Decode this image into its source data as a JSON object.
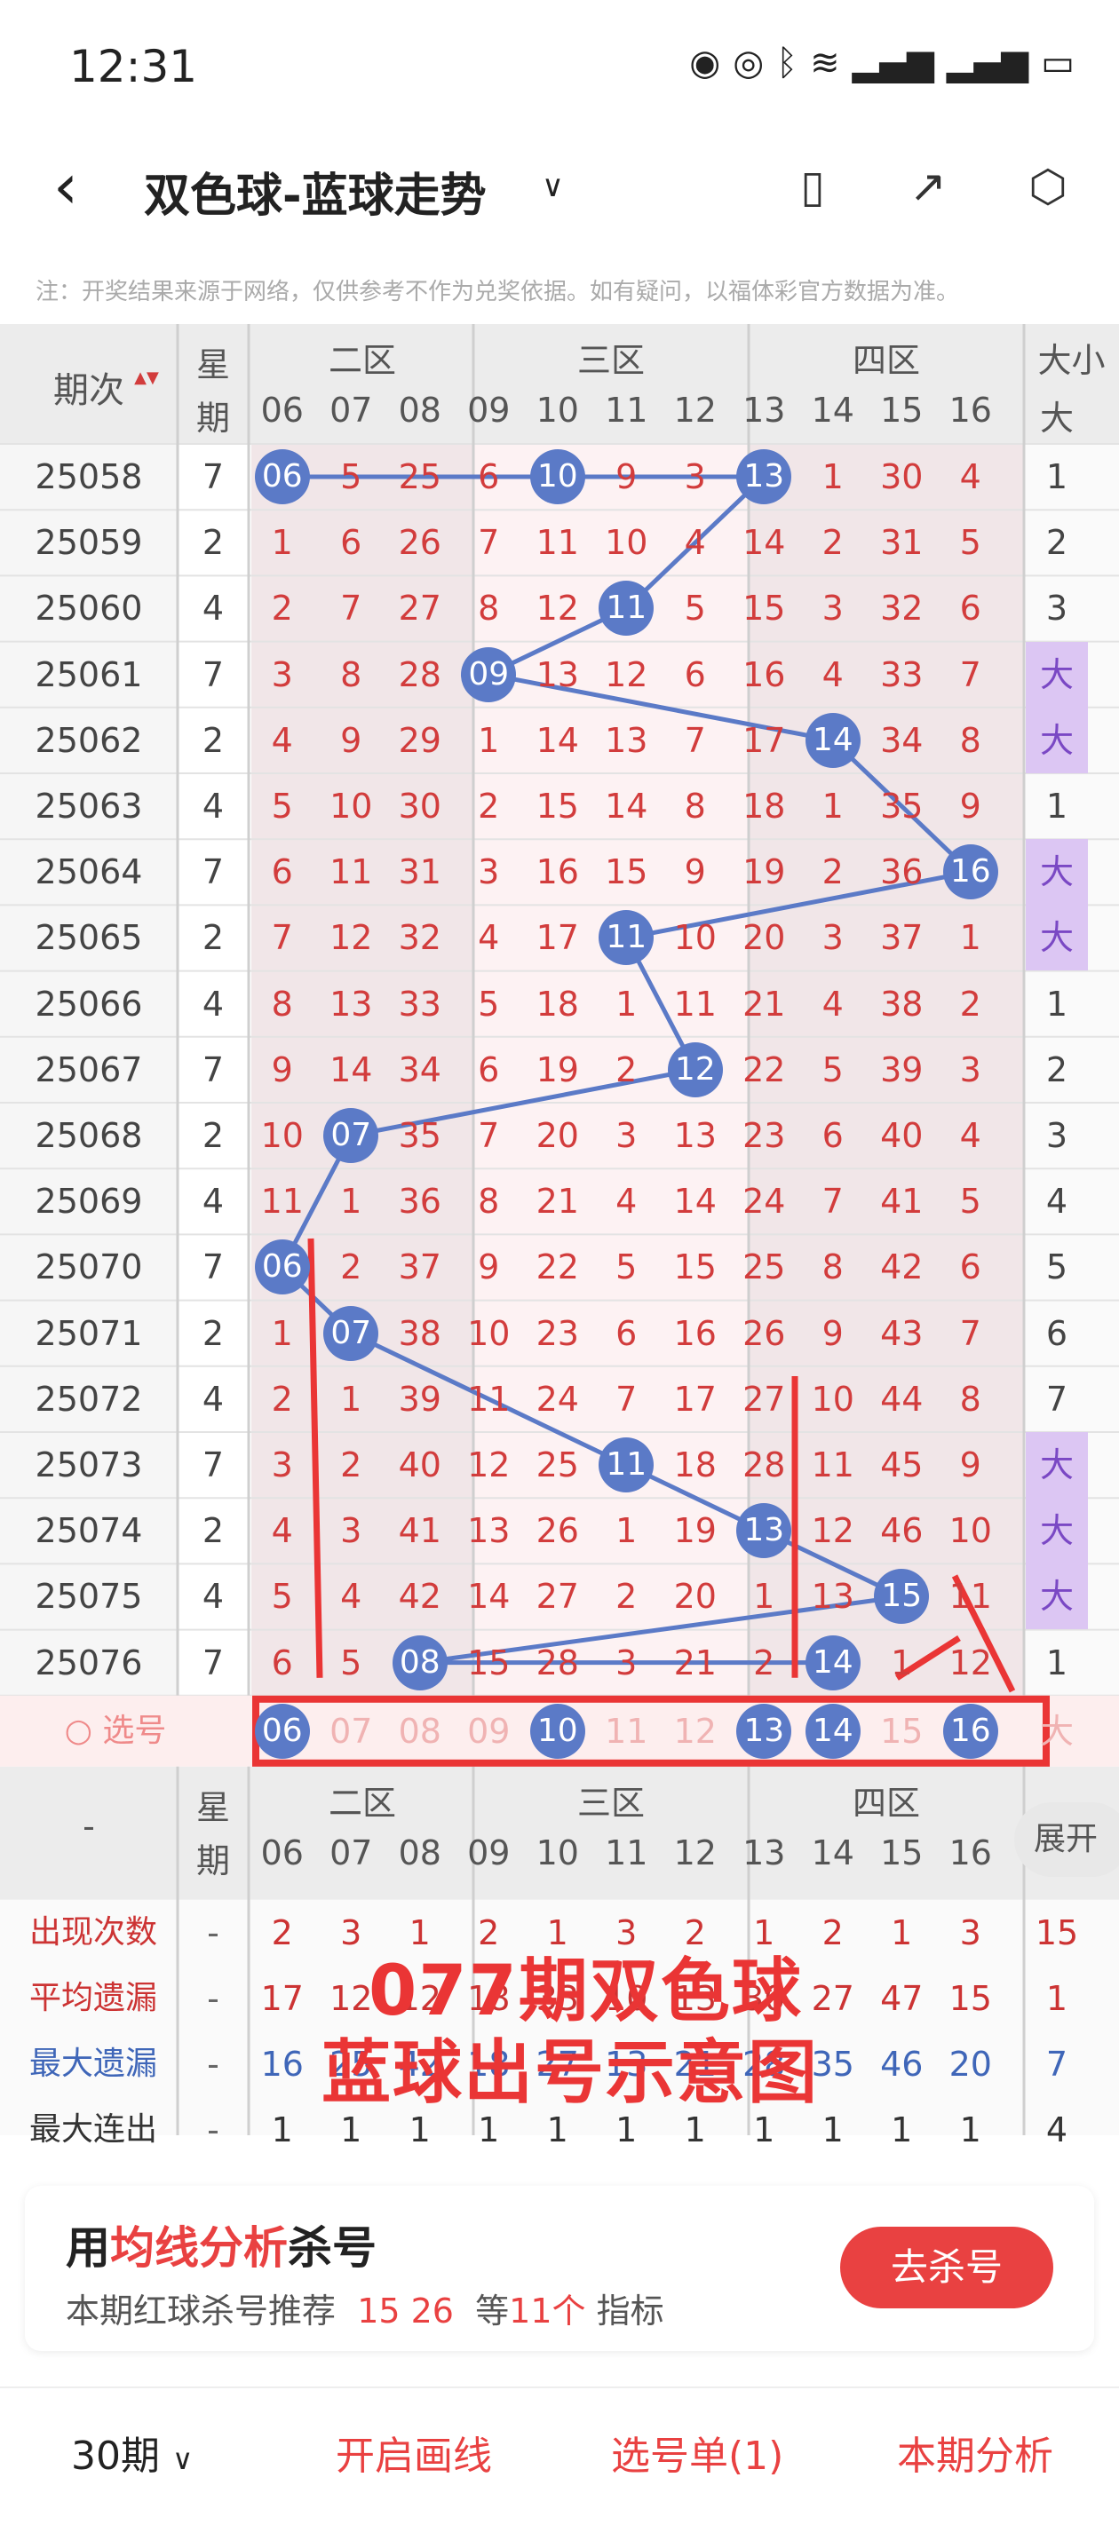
{
  "status": {
    "time": "12:31"
  },
  "header": {
    "title": "双色球-蓝球走势"
  },
  "note": "注：开奖结果来源于网络，仅供参考不作为兑奖依据。如有疑问，以福体彩官方数据为准。",
  "table": {
    "head_period": "期次",
    "head_week": "星期",
    "zones": [
      "二区",
      "三区",
      "四区",
      "大小"
    ],
    "numbers": [
      "06",
      "07",
      "08",
      "09",
      "10",
      "11",
      "12",
      "13",
      "14",
      "15",
      "16"
    ],
    "size_col_label": "大",
    "rows": [
      {
        "period": "25058",
        "week": "7",
        "vals": [
          "06",
          "5",
          "25",
          "6",
          "10",
          "9",
          "3",
          "13",
          "1",
          "30",
          "4"
        ],
        "size": "1"
      },
      {
        "period": "25059",
        "week": "2",
        "vals": [
          "1",
          "6",
          "26",
          "7",
          "11",
          "10",
          "4",
          "14",
          "2",
          "31",
          "5"
        ],
        "size": "2"
      },
      {
        "period": "25060",
        "week": "4",
        "vals": [
          "2",
          "7",
          "27",
          "8",
          "12",
          "11",
          "5",
          "15",
          "3",
          "32",
          "6"
        ],
        "size": "3"
      },
      {
        "period": "25061",
        "week": "7",
        "vals": [
          "3",
          "8",
          "28",
          "09",
          "13",
          "12",
          "6",
          "16",
          "4",
          "33",
          "7"
        ],
        "size": "大"
      },
      {
        "period": "25062",
        "week": "2",
        "vals": [
          "4",
          "9",
          "29",
          "1",
          "14",
          "13",
          "7",
          "17",
          "14",
          "34",
          "8"
        ],
        "size": "大"
      },
      {
        "period": "25063",
        "week": "4",
        "vals": [
          "5",
          "10",
          "30",
          "2",
          "15",
          "14",
          "8",
          "18",
          "1",
          "35",
          "9"
        ],
        "size": "1"
      },
      {
        "period": "25064",
        "week": "7",
        "vals": [
          "6",
          "11",
          "31",
          "3",
          "16",
          "15",
          "9",
          "19",
          "2",
          "36",
          "16"
        ],
        "size": "大"
      },
      {
        "period": "25065",
        "week": "2",
        "vals": [
          "7",
          "12",
          "32",
          "4",
          "17",
          "11",
          "10",
          "20",
          "3",
          "37",
          "1"
        ],
        "size": "大"
      },
      {
        "period": "25066",
        "week": "4",
        "vals": [
          "8",
          "13",
          "33",
          "5",
          "18",
          "1",
          "11",
          "21",
          "4",
          "38",
          "2"
        ],
        "size": "1"
      },
      {
        "period": "25067",
        "week": "7",
        "vals": [
          "9",
          "14",
          "34",
          "6",
          "19",
          "2",
          "12",
          "22",
          "5",
          "39",
          "3"
        ],
        "size": "2"
      },
      {
        "period": "25068",
        "week": "2",
        "vals": [
          "10",
          "07",
          "35",
          "7",
          "20",
          "3",
          "13",
          "23",
          "6",
          "40",
          "4"
        ],
        "size": "3"
      },
      {
        "period": "25069",
        "week": "4",
        "vals": [
          "11",
          "1",
          "36",
          "8",
          "21",
          "4",
          "14",
          "24",
          "7",
          "41",
          "5"
        ],
        "size": "4"
      },
      {
        "period": "25070",
        "week": "7",
        "vals": [
          "06",
          "2",
          "37",
          "9",
          "22",
          "5",
          "15",
          "25",
          "8",
          "42",
          "6"
        ],
        "size": "5"
      },
      {
        "period": "25071",
        "week": "2",
        "vals": [
          "1",
          "07",
          "38",
          "10",
          "23",
          "6",
          "16",
          "26",
          "9",
          "43",
          "7"
        ],
        "size": "6"
      },
      {
        "period": "25072",
        "week": "4",
        "vals": [
          "2",
          "1",
          "39",
          "11",
          "24",
          "7",
          "17",
          "27",
          "10",
          "44",
          "8"
        ],
        "size": "7"
      },
      {
        "period": "25073",
        "week": "7",
        "vals": [
          "3",
          "2",
          "40",
          "12",
          "25",
          "11",
          "18",
          "28",
          "11",
          "45",
          "9"
        ],
        "size": "大"
      },
      {
        "period": "25074",
        "week": "2",
        "vals": [
          "4",
          "3",
          "41",
          "13",
          "26",
          "1",
          "19",
          "13",
          "12",
          "46",
          "10"
        ],
        "size": "大"
      },
      {
        "period": "25075",
        "week": "4",
        "vals": [
          "5",
          "4",
          "42",
          "14",
          "27",
          "2",
          "20",
          "1",
          "13",
          "15",
          "11"
        ],
        "size": "大"
      },
      {
        "period": "25076",
        "week": "7",
        "vals": [
          "6",
          "5",
          "08",
          "15",
          "28",
          "3",
          "21",
          "2",
          "14",
          "1",
          "12"
        ],
        "size": "1"
      }
    ],
    "select_label": "选号",
    "select_row": [
      "06",
      "07",
      "08",
      "09",
      "10",
      "11",
      "12",
      "13",
      "14",
      "15",
      "16"
    ],
    "select_size": "大",
    "stats_head_dash": "-",
    "stats": [
      {
        "label": "出现次数",
        "dash": "-",
        "vals": [
          "2",
          "3",
          "1",
          "2",
          "1",
          "3",
          "2",
          "1",
          "2",
          "1",
          "3"
        ],
        "size": "15"
      },
      {
        "label": "平均遗漏",
        "dash": "-",
        "vals": [
          "17",
          "12",
          "12",
          "18",
          "33",
          "10",
          "13",
          "30",
          "27",
          "47",
          "15"
        ],
        "size": "1"
      },
      {
        "label": "最大遗漏",
        "dash": "-",
        "vals": [
          "16",
          "25",
          "42",
          "18",
          "27",
          "13",
          "21",
          "28",
          "35",
          "46",
          "20"
        ],
        "size": "7"
      },
      {
        "label": "最大连出",
        "dash": "-",
        "vals": [
          "1",
          "1",
          "1",
          "1",
          "1",
          "1",
          "1",
          "1",
          "1",
          "1",
          "1"
        ],
        "size": "4"
      }
    ],
    "expand": "展开"
  },
  "overlay": {
    "line1": "077期双色球",
    "line2": "蓝球出号示意图"
  },
  "promo": {
    "title_pre": "用",
    "title_hl": "均线分析",
    "title_post": "杀号",
    "sub_pre": "本期红球杀号推荐",
    "sub_nums": "15 26",
    "sub_mid": "等",
    "sub_count": "11个",
    "sub_post": "指标",
    "button": "去杀号"
  },
  "bottom": {
    "periods": "30期",
    "draw": "开启画线",
    "list": "选号单(1)",
    "analysis": "本期分析"
  }
}
